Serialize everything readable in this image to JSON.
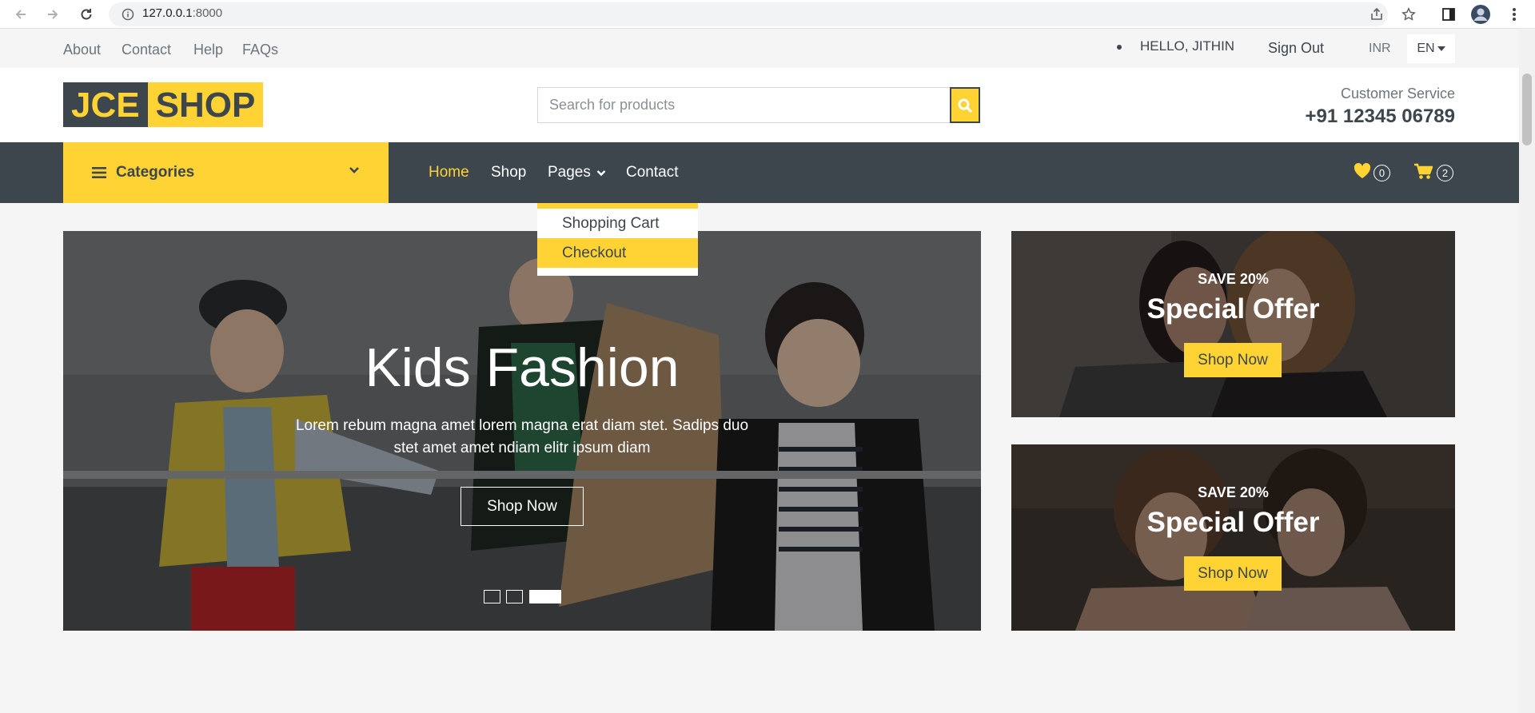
{
  "browser": {
    "url_host": "127.0.0.1",
    "url_port": ":8000"
  },
  "topbar": {
    "links": [
      "About",
      "Contact",
      "Help",
      "FAQs"
    ],
    "greeting": "HELLO, JITHIN",
    "sign_out": "Sign Out",
    "currency": "INR",
    "language": "EN"
  },
  "header": {
    "logo_part1": "JCE",
    "logo_part2": "SHOP",
    "search_placeholder": "Search for products",
    "cs_label": "Customer Service",
    "cs_phone": "+91 12345 06789"
  },
  "navbar": {
    "categories_label": "Categories",
    "links": [
      "Home",
      "Shop",
      "Pages",
      "Contact"
    ],
    "wishlist_count": "0",
    "cart_count": "2"
  },
  "dropdown": {
    "items": [
      "Shopping Cart",
      "Checkout"
    ]
  },
  "hero": {
    "title": "Kids Fashion",
    "subtitle": "Lorem rebum magna amet lorem magna erat diam stet. Sadips duo stet amet amet ndiam elitr ipsum diam",
    "button": "Shop Now"
  },
  "offers": [
    {
      "save": "SAVE 20%",
      "title": "Special Offer",
      "button": "Shop Now"
    },
    {
      "save": "SAVE 20%",
      "title": "Special Offer",
      "button": "Shop Now"
    }
  ],
  "colors": {
    "accent": "#ffd333",
    "dark": "#3d464d",
    "background": "#f5f5f5"
  }
}
